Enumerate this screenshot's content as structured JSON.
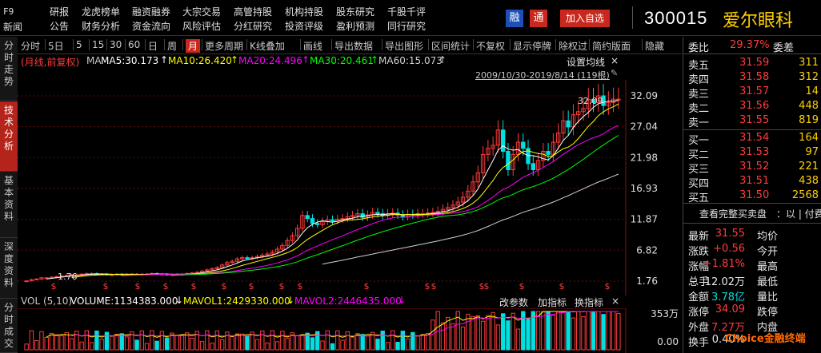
{
  "top_menu": {
    "f9_label": "F9",
    "f9_sub": "新闻",
    "row1": [
      "研报",
      "龙虎榜单",
      "融资融券",
      "大宗交易",
      "高管持股",
      "机构持股",
      "股东研究",
      "千股千评"
    ],
    "row2": [
      "公告",
      "财务分析",
      "资金流向",
      "风险评估",
      "分红研究",
      "投资评级",
      "盈利预测",
      "同行研究"
    ],
    "btn_margin": "融",
    "btn_tong": "通",
    "add_watch": "加入自选",
    "stock_code": "300015",
    "stock_name": "爱尔眼科"
  },
  "left_tabs": [
    "分时走势",
    "技术分析",
    "基本资料",
    "深度资料",
    "分时成交"
  ],
  "toolbar": [
    "分时",
    "5日",
    "5",
    "15",
    "30",
    "60",
    "日",
    "周",
    "月",
    "更多周期",
    "K线叠加",
    "画线",
    "导出数据",
    "导出图形",
    "区间统计",
    "不复权",
    "显示停牌",
    "除权过",
    "简约版面",
    "隐藏"
  ],
  "toolbar_active": "月",
  "chart_header": {
    "period_label": "(月线,前复权)",
    "ma_label": "MA",
    "ma5": "MA5:30.173",
    "ma10": "MA10:26.420",
    "ma20": "MA20:24.496",
    "ma30": "MA30:20.461",
    "ma60": "MA60:15.073",
    "settings": "设置均线",
    "range": "2009/10/30-2019/8/14 (119根)"
  },
  "price_axis": [
    "32.09",
    "27.04",
    "21.98",
    "16.93",
    "11.87",
    "6.82",
    "1.76"
  ],
  "annotations": {
    "high_label": "32.09",
    "low_label": "1.76"
  },
  "dividend_marker": "$",
  "volume_header": {
    "vol_label": "VOL (5,10)",
    "volume": "VOLUME:1134383.000",
    "mavol1": "MAVOL1:2429330.000",
    "mavol2": "MAVOL2:2446435.000",
    "change_params": "改参数",
    "add_indicator": "加指标",
    "switch_indicator": "换指标",
    "close": "×"
  },
  "volume_axis": [
    "353万",
    "0.00"
  ],
  "orderbook": {
    "weibi_label": "委比",
    "weibi_value": "29.37%",
    "weicha_label": "委差",
    "weicha_value": "",
    "asks": [
      {
        "label": "卖五",
        "price": "31.59",
        "vol": "311"
      },
      {
        "label": "卖四",
        "price": "31.58",
        "vol": "312"
      },
      {
        "label": "卖三",
        "price": "31.57",
        "vol": "14"
      },
      {
        "label": "卖二",
        "price": "31.56",
        "vol": "448"
      },
      {
        "label": "卖一",
        "price": "31.55",
        "vol": "819"
      }
    ],
    "bids": [
      {
        "label": "买一",
        "price": "31.54",
        "vol": "164"
      },
      {
        "label": "买二",
        "price": "31.53",
        "vol": "97"
      },
      {
        "label": "买三",
        "price": "31.52",
        "vol": "221"
      },
      {
        "label": "买四",
        "price": "31.51",
        "vol": "438"
      },
      {
        "label": "买五",
        "price": "31.50",
        "vol": "2568"
      }
    ],
    "full_book_link": "查看完整买卖盘",
    "full_book_suffix": "：以 | 付费"
  },
  "quote": [
    {
      "l1": "最新",
      "v1": "31.55",
      "c1": "red",
      "l2": "均价",
      "v2": "",
      "c2": "red"
    },
    {
      "l1": "涨跌",
      "v1": "+0.56",
      "c1": "red",
      "l2": "今开",
      "v2": "",
      "c2": "red"
    },
    {
      "l1": "涨幅",
      "v1": "+1.81%",
      "c1": "red",
      "l2": "最高",
      "v2": "",
      "c2": "red"
    },
    {
      "l1": "总手",
      "v1": "12.02万",
      "c1": "white",
      "l2": "最低",
      "v2": "",
      "c2": "red"
    },
    {
      "l1": "金额",
      "v1": "3.78亿",
      "c1": "cyan",
      "l2": "量比",
      "v2": "",
      "c2": "red"
    },
    {
      "l1": "涨停",
      "v1": "34.09",
      "c1": "red",
      "l2": "跌停",
      "v2": "",
      "c2": "green"
    },
    {
      "l1": "外盘",
      "v1": "7.27万",
      "c1": "red",
      "l2": "内盘",
      "v2": "",
      "c2": "green"
    },
    {
      "l1": "换手",
      "v1": "0.40%",
      "c1": "white",
      "l2": "",
      "v2": "",
      "c2": "white"
    }
  ],
  "watermark": "Choice金融终端",
  "colors": {
    "up": "#ff3b3b",
    "down": "#00e0e0",
    "ma5": "#ffffff",
    "ma10": "#ffff00",
    "ma20": "#ff00ff",
    "ma30": "#00ff00",
    "ma60": "#d0d0d0",
    "accent": "#c8281e"
  },
  "chart_data": {
    "type": "candlestick",
    "title": "(月线,前复权)",
    "period": "monthly",
    "range": "2009/10/30-2019/8/14",
    "bars_count": 119,
    "ylim": [
      1.76,
      32.09
    ],
    "y_ticks": [
      32.09,
      27.04,
      21.98,
      16.93,
      11.87,
      6.82,
      1.76
    ],
    "close_approx": [
      1.8,
      2.0,
      2.1,
      2.3,
      2.3,
      2.4,
      2.5,
      2.6,
      2.7,
      2.8,
      2.8,
      2.9,
      3.0,
      3.0,
      2.9,
      2.9,
      2.8,
      2.8,
      2.9,
      2.8,
      2.9,
      2.9,
      2.8,
      2.9,
      2.9,
      3.0,
      2.9,
      2.9,
      2.8,
      2.8,
      2.9,
      2.9,
      3.0,
      3.1,
      3.2,
      3.4,
      3.6,
      3.8,
      4.0,
      4.4,
      4.8,
      5.0,
      5.4,
      5.6,
      5.5,
      5.6,
      5.8,
      6.0,
      6.2,
      6.5,
      7.0,
      7.6,
      8.4,
      9.2,
      10.4,
      12.5,
      12.0,
      11.2,
      11.0,
      11.5,
      11.8,
      11.6,
      11.9,
      12.0,
      12.3,
      12.5,
      12.8,
      12.2,
      12.6,
      13.0,
      12.8,
      12.5,
      12.8,
      12.9,
      12.6,
      12.3,
      12.7,
      12.6,
      12.8,
      12.8,
      12.9,
      13.0,
      13.2,
      13.5,
      13.8,
      14.2,
      14.7,
      15.5,
      16.5,
      18.0,
      19.5,
      22.5,
      23.5,
      24.0,
      26.5,
      23.0,
      20.0,
      22.5,
      24.5,
      23.5,
      21.0,
      20.0,
      21.5,
      23.0,
      22.5,
      24.5,
      26.0,
      28.0,
      27.0,
      29.0,
      29.5,
      30.0,
      31.5,
      31.0,
      32.09,
      30.5,
      31.0,
      31.55,
      31.55
    ],
    "series": [
      {
        "name": "MA5",
        "last": 30.173
      },
      {
        "name": "MA10",
        "last": 26.42
      },
      {
        "name": "MA20",
        "last": 24.496
      },
      {
        "name": "MA30",
        "last": 20.461
      },
      {
        "name": "MA60",
        "last": 15.073
      }
    ],
    "volume": {
      "last": 1134383.0,
      "mavol1": 2429330.0,
      "mavol2": 2446435.0,
      "ylim_label": "353万"
    }
  }
}
